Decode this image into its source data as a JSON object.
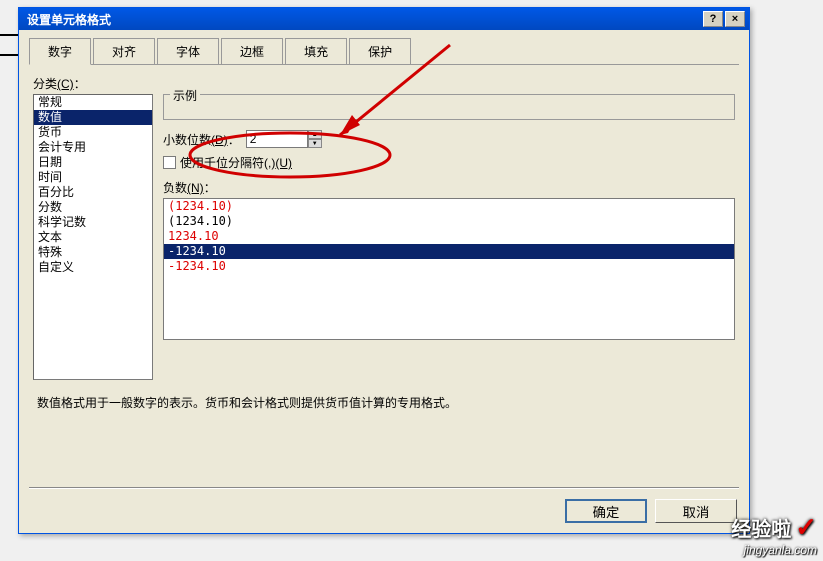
{
  "dialog": {
    "title": "设置单元格格式",
    "help_btn": "?",
    "close_btn": "×"
  },
  "tabs": [
    "数字",
    "对齐",
    "字体",
    "边框",
    "填充",
    "保护"
  ],
  "active_tab": 0,
  "category": {
    "label": "分类",
    "hotkey": "(C)",
    "suffix": "：",
    "items": [
      "常规",
      "数值",
      "货币",
      "会计专用",
      "日期",
      "时间",
      "百分比",
      "分数",
      "科学记数",
      "文本",
      "特殊",
      "自定义"
    ],
    "selected_index": 1
  },
  "sample": {
    "label": "示例"
  },
  "decimal": {
    "label": "小数位数",
    "hotkey": "(D)",
    "suffix": "：",
    "value": "2"
  },
  "thousands": {
    "label": "使用千位分隔符(,)",
    "hotkey": "(U)"
  },
  "negative": {
    "label": "负数",
    "hotkey": "(N)",
    "suffix": "：",
    "items": [
      {
        "text": "(1234.10)",
        "color": "red"
      },
      {
        "text": "(1234.10)",
        "color": "black"
      },
      {
        "text": "1234.10",
        "color": "red"
      },
      {
        "text": "-1234.10",
        "color": "black",
        "selected": true
      },
      {
        "text": "-1234.10",
        "color": "red"
      }
    ]
  },
  "description": "数值格式用于一般数字的表示。货币和会计格式则提供货币值计算的专用格式。",
  "footer": {
    "ok": "确定",
    "cancel": "取消"
  },
  "watermark": {
    "line1": "经验啦",
    "line2": "jingyanla.com"
  }
}
